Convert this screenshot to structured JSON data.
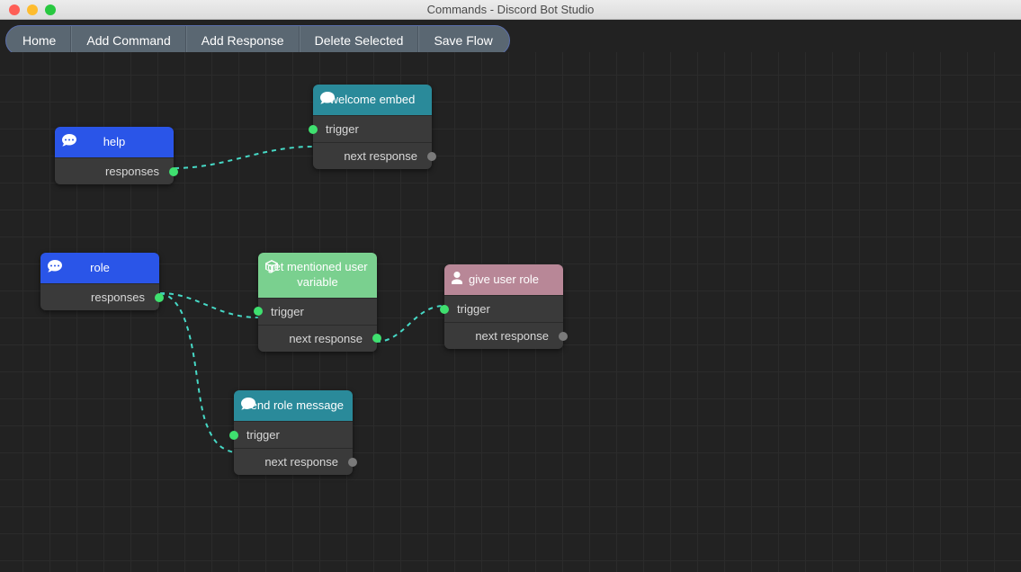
{
  "window": {
    "title": "Commands - Discord Bot Studio"
  },
  "toolbar": {
    "home": "Home",
    "add_command": "Add Command",
    "add_response": "Add Response",
    "delete_selected": "Delete Selected",
    "save_flow": "Save Flow"
  },
  "labels": {
    "trigger": "trigger",
    "responses": "responses",
    "next_response": "next response"
  },
  "nodes": {
    "help": {
      "title": "help"
    },
    "welcome_embed": {
      "title": "welcome embed"
    },
    "role": {
      "title": "role"
    },
    "get_mentioned": {
      "title": "get mentioned user variable"
    },
    "give_user_role": {
      "title": "give user role"
    },
    "send_role_message": {
      "title": "Send role message"
    }
  }
}
